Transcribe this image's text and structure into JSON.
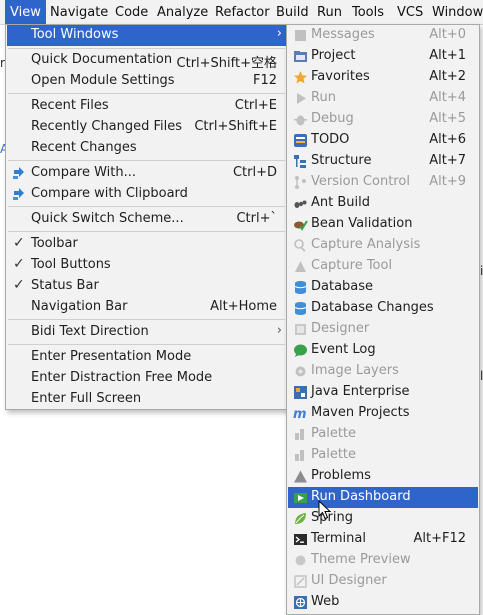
{
  "menubar": [
    "View",
    "Navigate",
    "Code",
    "Analyze",
    "Refactor",
    "Build",
    "Run",
    "Tools",
    "VCS",
    "Window"
  ],
  "view_menu": {
    "items": [
      {
        "label": "Tool Windows",
        "shortcut": "",
        "submenu": true,
        "highlighted": true
      },
      {
        "label": "Quick Documentation",
        "shortcut": "Ctrl+Shift+空格"
      },
      {
        "label": "Open Module Settings",
        "shortcut": "F12"
      },
      {
        "label": "Recent Files",
        "shortcut": "Ctrl+E"
      },
      {
        "label": "Recently Changed Files",
        "shortcut": "Ctrl+Shift+E"
      },
      {
        "label": "Recent Changes",
        "shortcut": ""
      },
      {
        "label": "Compare With...",
        "shortcut": "Ctrl+D"
      },
      {
        "label": "Compare with Clipboard",
        "shortcut": ""
      },
      {
        "label": "Quick Switch Scheme...",
        "shortcut": "Ctrl+`"
      },
      {
        "label": "Toolbar",
        "shortcut": "",
        "checked": true
      },
      {
        "label": "Tool Buttons",
        "shortcut": "",
        "checked": true
      },
      {
        "label": "Status Bar",
        "shortcut": "",
        "checked": true
      },
      {
        "label": "Navigation Bar",
        "shortcut": "Alt+Home"
      },
      {
        "label": "Bidi Text Direction",
        "shortcut": "",
        "submenu": true
      },
      {
        "label": "Enter Presentation Mode",
        "shortcut": ""
      },
      {
        "label": "Enter Distraction Free Mode",
        "shortcut": ""
      },
      {
        "label": "Enter Full Screen",
        "shortcut": ""
      }
    ]
  },
  "tool_windows": {
    "items": [
      {
        "label": "Messages",
        "shortcut": "Alt+0",
        "disabled": true,
        "icon": "messages-icon"
      },
      {
        "label": "Project",
        "shortcut": "Alt+1",
        "icon": "project-icon"
      },
      {
        "label": "Favorites",
        "shortcut": "Alt+2",
        "icon": "star-icon"
      },
      {
        "label": "Run",
        "shortcut": "Alt+4",
        "disabled": true,
        "icon": "run-icon"
      },
      {
        "label": "Debug",
        "shortcut": "Alt+5",
        "disabled": true,
        "icon": "debug-icon"
      },
      {
        "label": "TODO",
        "shortcut": "Alt+6",
        "icon": "todo-icon"
      },
      {
        "label": "Structure",
        "shortcut": "Alt+7",
        "icon": "structure-icon"
      },
      {
        "label": "Version Control",
        "shortcut": "Alt+9",
        "disabled": true,
        "icon": "version-control-icon"
      },
      {
        "label": "Ant Build",
        "shortcut": "",
        "icon": "ant-icon"
      },
      {
        "label": "Bean Validation",
        "shortcut": "",
        "icon": "bean-validation-icon"
      },
      {
        "label": "Capture Analysis",
        "shortcut": "",
        "disabled": true,
        "icon": "capture-analysis-icon"
      },
      {
        "label": "Capture Tool",
        "shortcut": "",
        "disabled": true,
        "icon": "capture-tool-icon"
      },
      {
        "label": "Database",
        "shortcut": "",
        "icon": "database-icon"
      },
      {
        "label": "Database Changes",
        "shortcut": "",
        "icon": "database-changes-icon"
      },
      {
        "label": "Designer",
        "shortcut": "",
        "disabled": true,
        "icon": "designer-icon"
      },
      {
        "label": "Event Log",
        "shortcut": "",
        "icon": "event-log-icon"
      },
      {
        "label": "Image Layers",
        "shortcut": "",
        "disabled": true,
        "icon": "image-layers-icon"
      },
      {
        "label": "Java Enterprise",
        "shortcut": "",
        "icon": "java-enterprise-icon"
      },
      {
        "label": "Maven Projects",
        "shortcut": "",
        "icon": "maven-icon"
      },
      {
        "label": "Palette",
        "shortcut": "",
        "disabled": true,
        "icon": "palette-icon"
      },
      {
        "label": "Palette",
        "shortcut": "",
        "disabled": true,
        "icon": "palette-icon"
      },
      {
        "label": "Problems",
        "shortcut": "",
        "icon": "problems-icon"
      },
      {
        "label": "Run Dashboard",
        "shortcut": "",
        "highlighted": true,
        "icon": "run-dashboard-icon"
      },
      {
        "label": "Spring",
        "shortcut": "",
        "icon": "spring-icon"
      },
      {
        "label": "Terminal",
        "shortcut": "Alt+F12",
        "icon": "terminal-icon"
      },
      {
        "label": "Theme Preview",
        "shortcut": "",
        "disabled": true,
        "icon": "theme-preview-icon"
      },
      {
        "label": "UI Designer",
        "shortcut": "",
        "disabled": true,
        "icon": "ui-designer-icon"
      },
      {
        "label": "Web",
        "shortcut": "",
        "icon": "web-icon"
      }
    ]
  },
  "colors": {
    "highlight": "#2f65ca",
    "menu_bg": "#f2f2f2",
    "disabled_text": "#9a9a9a"
  }
}
